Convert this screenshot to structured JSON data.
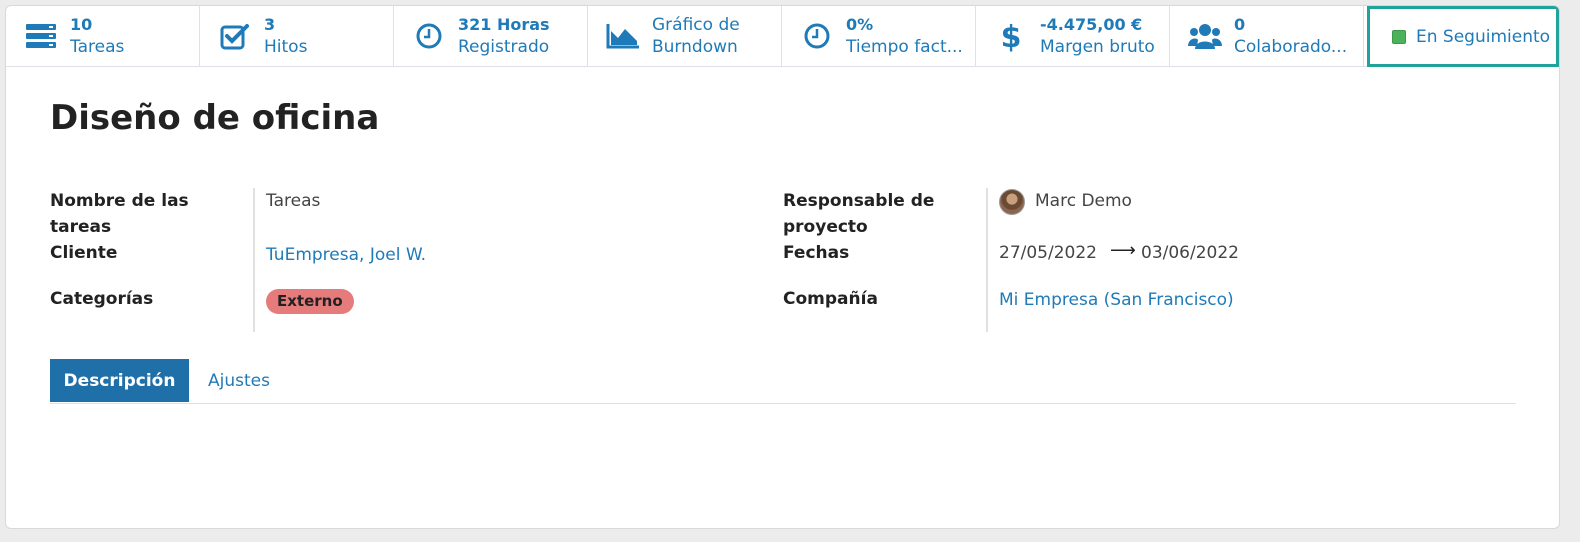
{
  "smart_buttons": [
    {
      "icon": "tasks-icon",
      "value": "10",
      "label": "Tareas"
    },
    {
      "icon": "milestones-icon",
      "value": "3",
      "label": "Hitos"
    },
    {
      "icon": "clock-icon",
      "value": "321 Horas",
      "label": "Registrado"
    },
    {
      "icon": "burndown-chart-icon",
      "line1": "Gráfico de",
      "line2": "Burndown"
    },
    {
      "icon": "clock-icon",
      "value": "0%",
      "label": "Tiempo fact..."
    },
    {
      "icon": "dollar-icon",
      "value": "-4.475,00 €",
      "label": "Margen bruto"
    },
    {
      "icon": "users-icon",
      "value": "0",
      "label": "Colaborado..."
    }
  ],
  "status": {
    "label": "En Seguimiento",
    "color": "#4bb25a"
  },
  "record": {
    "title": "Diseño de oficina"
  },
  "fields": {
    "task_name_label_line1": "Nombre de las",
    "task_name_label_line2": "tareas",
    "task_name_value": "Tareas",
    "customer_label": "Cliente",
    "customer_value": "TuEmpresa, Joel W.",
    "tags_label": "Categorías",
    "tag_value": "Externo",
    "manager_label_line1": "Responsable de",
    "manager_label_line2": "proyecto",
    "manager_value": "Marc Demo",
    "dates_label": "Fechas",
    "date_start": "27/05/2022",
    "date_arrow": "⟶",
    "date_end": "03/06/2022",
    "company_label": "Compañía",
    "company_value": "Mi Empresa (San Francisco)"
  },
  "tabs": [
    {
      "label": "Descripción",
      "active": true
    },
    {
      "label": "Ajustes",
      "active": false
    }
  ],
  "colors": {
    "accent": "#1f7ab8",
    "tab_active": "#1f6fa8",
    "highlight_border": "#1fa39b",
    "tag": "#e57b7b"
  }
}
